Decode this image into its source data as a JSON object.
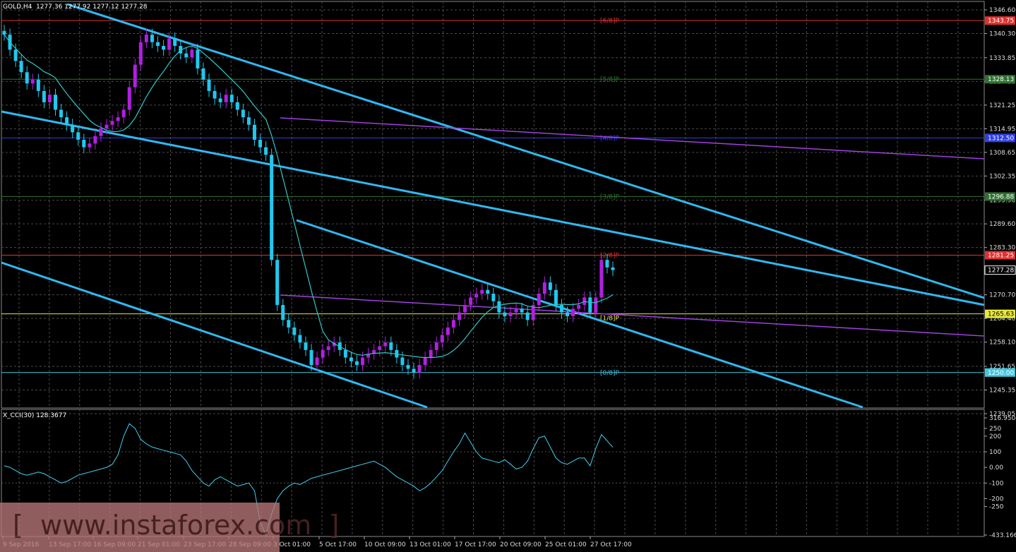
{
  "header": {
    "price_title": "GOLD,H4  1277.36 1277.92 1277.12 1277.28",
    "indicator_title": "X_CCI(30) 128.3677"
  },
  "watermark": "[  www.instaforex.com  ]",
  "colors": {
    "background": "#000000",
    "grid": "#4a4a4a",
    "bull": "#b020e0",
    "bear": "#20c8f0",
    "channel": "#30b8f0",
    "ma": "#30c8c8",
    "cci": "#40d0f0",
    "trend": "#a040e0"
  },
  "chart_data": [
    {
      "type": "candlestick",
      "symbol": "GOLD",
      "timeframe": "H4",
      "ohlc_last": {
        "open": 1277.36,
        "high": 1277.92,
        "low": 1277.12,
        "close": 1277.28
      },
      "ylim": [
        1239.05,
        1346.6
      ],
      "y_ticks": [
        "1346.60",
        "1340.30",
        "1333.85",
        "1327.55",
        "1321.25",
        "1314.95",
        "1308.65",
        "1302.35",
        "1295.90",
        "1289.60",
        "1283.30",
        "1277.28",
        "1270.70",
        "1264.40",
        "1258.10",
        "1251.65",
        "1245.35",
        "1239.05"
      ],
      "x_tick_labels": [
        "9 Sep 2016",
        "13 Sep 17:00",
        "16 Sep 09:00",
        "21 Sep 01:00",
        "23 Sep 17:00",
        "28 Sep 09:00",
        "3 Oct 01:00",
        "5 Oct 17:00",
        "10 Oct 09:00",
        "13 Oct 01:00",
        "17 Oct 17:00",
        "20 Oct 09:00",
        "25 Oct 01:00",
        "27 Oct 17:00"
      ],
      "current_price": "1277.28",
      "murrey_levels": [
        {
          "label": "[6/8]P",
          "price": 1343.75,
          "price_label": "1343.75",
          "color": "#e03030"
        },
        {
          "label": "[5/8]P",
          "price": 1328.13,
          "price_label": "1328.13",
          "color": "#307030"
        },
        {
          "label": "[4/8]P",
          "price": 1312.5,
          "price_label": "1312.50",
          "color": "#3040e0"
        },
        {
          "label": "[3/8]P",
          "price": 1296.88,
          "price_label": "1296.88",
          "color": "#307030"
        },
        {
          "label": "[2/8]P",
          "price": 1281.25,
          "price_label": "1281.25",
          "color": "#e03030"
        },
        {
          "label": "[1/8]P",
          "price": 1265.63,
          "price_label": "1265.63",
          "color": "#e8e840"
        },
        {
          "label": "[0/8]P",
          "price": 1250.0,
          "price_label": "1250.00",
          "color": "#40c8e0"
        }
      ],
      "closes": [
        1340,
        1336,
        1333,
        1330,
        1327,
        1328,
        1325,
        1322,
        1324,
        1320,
        1318,
        1316,
        1314,
        1312,
        1310,
        1311,
        1313,
        1315,
        1316,
        1317,
        1318,
        1320,
        1326,
        1332,
        1338,
        1340,
        1338,
        1337,
        1336,
        1339,
        1337,
        1335,
        1334,
        1336,
        1331,
        1328,
        1325,
        1323,
        1322,
        1324,
        1322,
        1320,
        1318,
        1316,
        1312,
        1310,
        1308,
        1280,
        1268,
        1264,
        1262,
        1260,
        1258,
        1256,
        1252,
        1254,
        1256,
        1257,
        1258,
        1256,
        1254,
        1253,
        1252,
        1254,
        1255,
        1256,
        1257,
        1258,
        1256,
        1254,
        1252,
        1251,
        1250,
        1252,
        1254,
        1256,
        1258,
        1260,
        1262,
        1264,
        1266,
        1268,
        1270,
        1271,
        1272,
        1271,
        1269,
        1266,
        1265,
        1266,
        1267,
        1266,
        1264,
        1268,
        1271,
        1274,
        1272,
        1268,
        1266,
        1265,
        1267,
        1268,
        1270,
        1266,
        1270,
        1280,
        1278,
        1277.28
      ],
      "cci_closes": [
        10,
        0,
        -20,
        -40,
        -50,
        -40,
        -30,
        -40,
        -60,
        -80,
        -100,
        -90,
        -70,
        -50,
        -40,
        -30,
        -20,
        -10,
        0,
        20,
        80,
        200,
        280,
        250,
        180,
        150,
        130,
        120,
        110,
        100,
        90,
        80,
        40,
        -20,
        -60,
        -100,
        -120,
        -80,
        -60,
        -80,
        -100,
        -120,
        -110,
        -100,
        -150,
        -350,
        -433,
        -300,
        -200,
        -150,
        -120,
        -100,
        -110,
        -90,
        -70,
        -60,
        -50,
        -40,
        -30,
        -20,
        -10,
        0,
        10,
        20,
        30,
        40,
        20,
        0,
        -30,
        -60,
        -80,
        -100,
        -120,
        -150,
        -130,
        -100,
        -60,
        -20,
        40,
        100,
        150,
        220,
        160,
        100,
        60,
        50,
        40,
        30,
        50,
        20,
        -10,
        0,
        40,
        120,
        190,
        200,
        130,
        60,
        30,
        20,
        40,
        60,
        60,
        10,
        120,
        210,
        170,
        128.37
      ],
      "cci_ylim": [
        -433.1663,
        316.9504
      ],
      "cci_ticks": [
        "316.9504",
        "250",
        "200",
        "100",
        "0.00",
        "-100",
        "-200",
        "-250",
        "-433.1663"
      ]
    }
  ]
}
